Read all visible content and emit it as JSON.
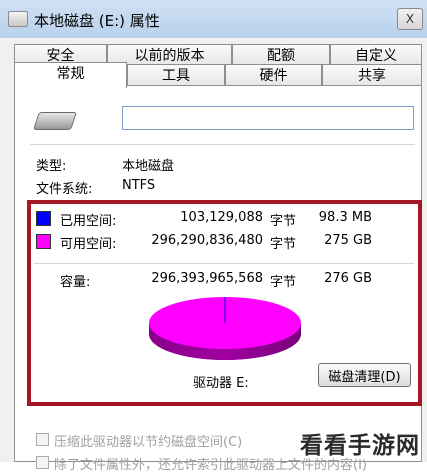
{
  "window": {
    "title": "本地磁盘 (E:) 属性",
    "close_label": "X"
  },
  "tabs_back": [
    "安全",
    "以前的版本",
    "配额",
    "自定义"
  ],
  "tabs_front": [
    "常规",
    "工具",
    "硬件",
    "共享"
  ],
  "drive": {
    "name_value": ""
  },
  "info": {
    "type_label": "类型:",
    "type_value": "本地磁盘",
    "fs_label": "文件系统:",
    "fs_value": "NTFS"
  },
  "usage": {
    "used_label": "已用空间:",
    "used_bytes": "103,129,088",
    "used_unit": "字节",
    "used_size": "98.3 MB",
    "free_label": "可用空间:",
    "free_bytes": "296,290,836,480",
    "free_unit": "字节",
    "free_size": "275 GB",
    "cap_label": "容量:",
    "cap_bytes": "296,393,965,568",
    "cap_unit": "字节",
    "cap_size": "276 GB",
    "drive_label": "驱动器 E:",
    "cleanup_label": "磁盘清理(D)",
    "used_color": "#0000ff",
    "free_color": "#ff00ff",
    "used_fraction": 0.0003
  },
  "options": {
    "compress_label": "压缩此驱动器以节约磁盘空间(C)",
    "index_label": "除了文件属性外，还允许索引此驱动器上文件的内容(I)"
  },
  "watermark": "看看手游网"
}
